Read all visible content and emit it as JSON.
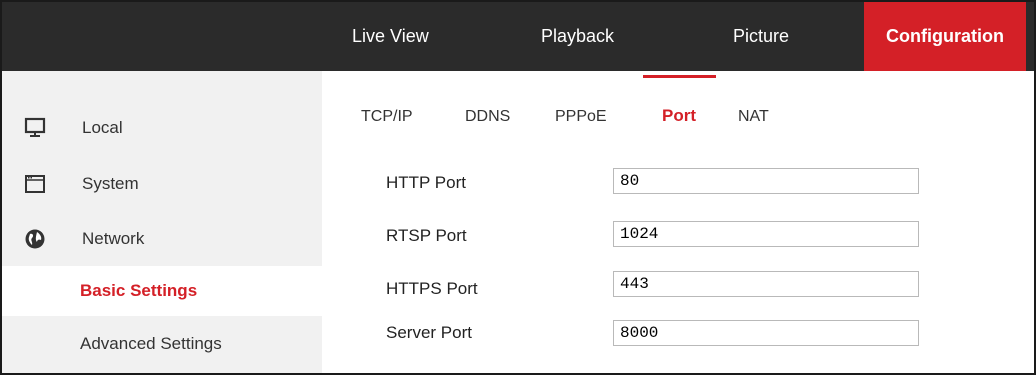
{
  "topnav": {
    "items": [
      {
        "label": "Live View"
      },
      {
        "label": "Playback"
      },
      {
        "label": "Picture"
      },
      {
        "label": "Configuration",
        "active": true
      }
    ]
  },
  "sidebar": {
    "items": [
      {
        "label": "Local",
        "icon": "monitor-icon"
      },
      {
        "label": "System",
        "icon": "window-icon"
      },
      {
        "label": "Network",
        "icon": "globe-icon"
      },
      {
        "label": "Basic Settings",
        "selected": true
      },
      {
        "label": "Advanced Settings"
      }
    ]
  },
  "tabs": {
    "items": [
      {
        "label": "TCP/IP"
      },
      {
        "label": "DDNS"
      },
      {
        "label": "PPPoE"
      },
      {
        "label": "Port",
        "active": true
      },
      {
        "label": "NAT"
      }
    ]
  },
  "form": {
    "fields": [
      {
        "label": "HTTP Port",
        "value": "80"
      },
      {
        "label": "RTSP Port",
        "value": "1024"
      },
      {
        "label": "HTTPS Port",
        "value": "443"
      },
      {
        "label": "Server Port",
        "value": "8000"
      }
    ]
  },
  "colors": {
    "accent": "#d42027",
    "topbar": "#2b2b2b",
    "sidebar": "#f1f1f1"
  }
}
